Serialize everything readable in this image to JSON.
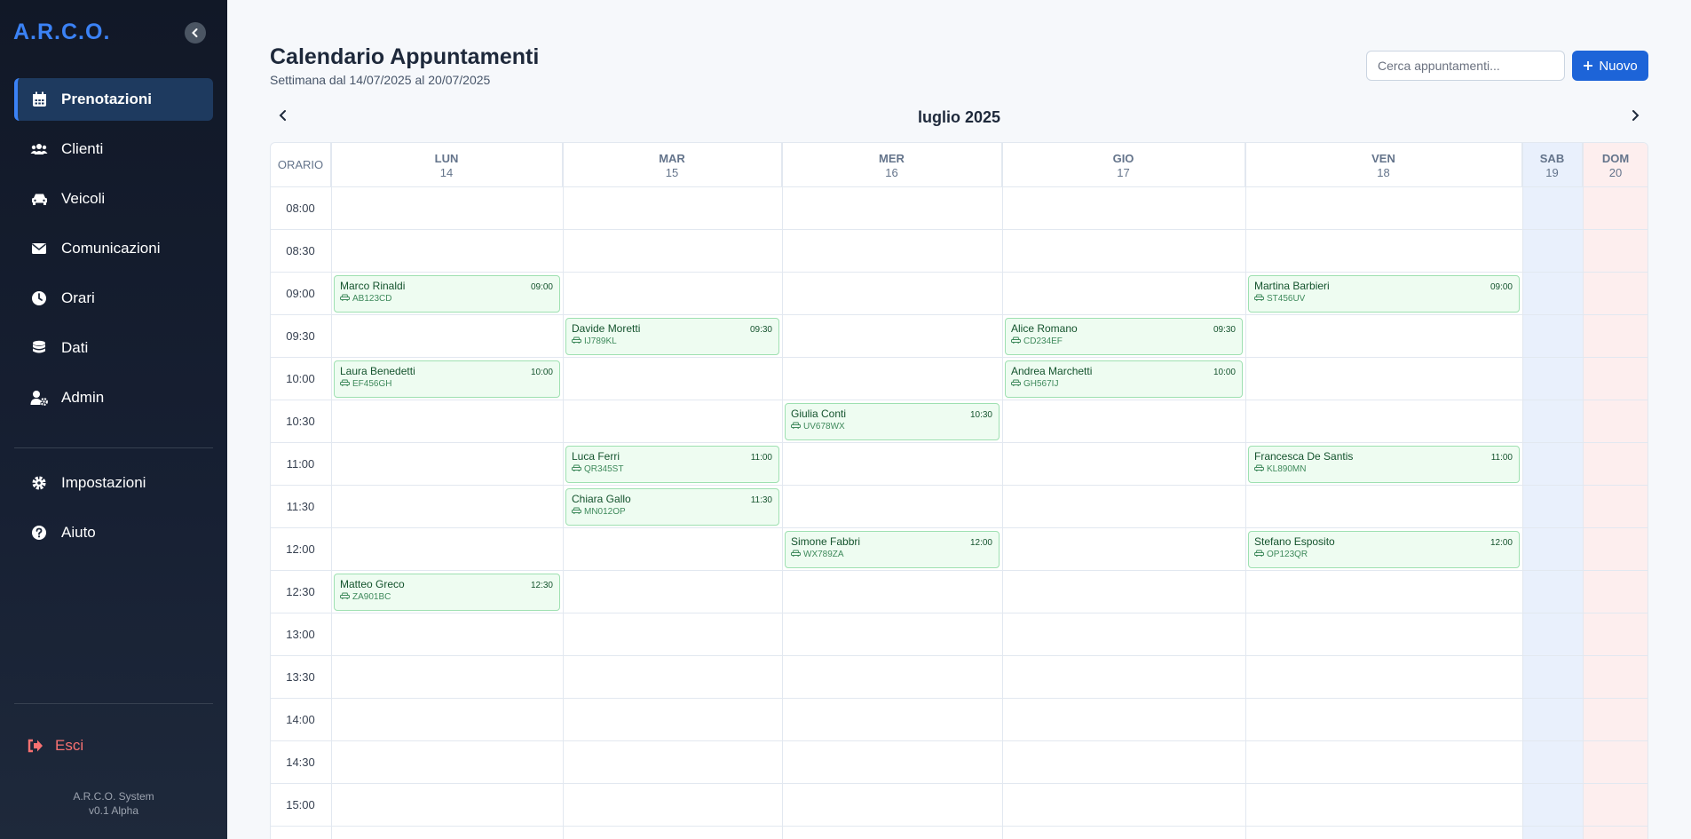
{
  "app": {
    "logo": "A.R.C.O.",
    "system_name": "A.R.C.O. System",
    "version": "v0.1 Alpha"
  },
  "sidebar": {
    "items": [
      {
        "label": "Prenotazioni",
        "icon": "calendar-icon",
        "active": true
      },
      {
        "label": "Clienti",
        "icon": "users-icon"
      },
      {
        "label": "Veicoli",
        "icon": "car-icon"
      },
      {
        "label": "Comunicazioni",
        "icon": "envelope-icon"
      },
      {
        "label": "Orari",
        "icon": "clock-icon"
      },
      {
        "label": "Dati",
        "icon": "database-icon"
      },
      {
        "label": "Admin",
        "icon": "user-gear-icon"
      }
    ],
    "secondary": [
      {
        "label": "Impostazioni",
        "icon": "gear-icon"
      },
      {
        "label": "Aiuto",
        "icon": "help-icon"
      }
    ],
    "logout": "Esci"
  },
  "header": {
    "title": "Calendario Appuntamenti",
    "subtitle": "Settimana dal 14/07/2025 al 20/07/2025",
    "search_placeholder": "Cerca appuntamenti...",
    "new_button": "Nuovo"
  },
  "calendar": {
    "month": "luglio 2025",
    "time_header": "ORARIO",
    "days": [
      {
        "name": "LUN",
        "num": "14"
      },
      {
        "name": "MAR",
        "num": "15"
      },
      {
        "name": "MER",
        "num": "16"
      },
      {
        "name": "GIO",
        "num": "17"
      },
      {
        "name": "VEN",
        "num": "18"
      },
      {
        "name": "SAB",
        "num": "19"
      },
      {
        "name": "DOM",
        "num": "20"
      }
    ],
    "times": [
      "08:00",
      "08:30",
      "09:00",
      "09:30",
      "10:00",
      "10:30",
      "11:00",
      "11:30",
      "12:00",
      "12:30",
      "13:00",
      "13:30",
      "14:00",
      "14:30",
      "15:00"
    ],
    "appointments": [
      {
        "day": 0,
        "slot": 2,
        "name": "Marco Rinaldi",
        "time": "09:00",
        "plate": "AB123CD"
      },
      {
        "day": 4,
        "slot": 2,
        "name": "Martina Barbieri",
        "time": "09:00",
        "plate": "ST456UV"
      },
      {
        "day": 1,
        "slot": 3,
        "name": "Davide Moretti",
        "time": "09:30",
        "plate": "IJ789KL"
      },
      {
        "day": 3,
        "slot": 3,
        "name": "Alice Romano",
        "time": "09:30",
        "plate": "CD234EF"
      },
      {
        "day": 0,
        "slot": 4,
        "name": "Laura Benedetti",
        "time": "10:00",
        "plate": "EF456GH"
      },
      {
        "day": 3,
        "slot": 4,
        "name": "Andrea Marchetti",
        "time": "10:00",
        "plate": "GH567IJ"
      },
      {
        "day": 2,
        "slot": 5,
        "name": "Giulia Conti",
        "time": "10:30",
        "plate": "UV678WX"
      },
      {
        "day": 1,
        "slot": 6,
        "name": "Luca Ferri",
        "time": "11:00",
        "plate": "QR345ST"
      },
      {
        "day": 4,
        "slot": 6,
        "name": "Francesca De Santis",
        "time": "11:00",
        "plate": "KL890MN"
      },
      {
        "day": 1,
        "slot": 7,
        "name": "Chiara Gallo",
        "time": "11:30",
        "plate": "MN012OP"
      },
      {
        "day": 2,
        "slot": 8,
        "name": "Simone Fabbri",
        "time": "12:00",
        "plate": "WX789ZA"
      },
      {
        "day": 4,
        "slot": 8,
        "name": "Stefano Esposito",
        "time": "12:00",
        "plate": "OP123QR"
      },
      {
        "day": 0,
        "slot": 9,
        "name": "Matteo Greco",
        "time": "12:30",
        "plate": "ZA901BC"
      }
    ]
  },
  "colors": {
    "accent": "#1d64d8",
    "sidebar_bg": "#111827",
    "appointment_bg": "#eefcf1",
    "appointment_border": "#9ee0b1",
    "logout": "#f87171"
  }
}
